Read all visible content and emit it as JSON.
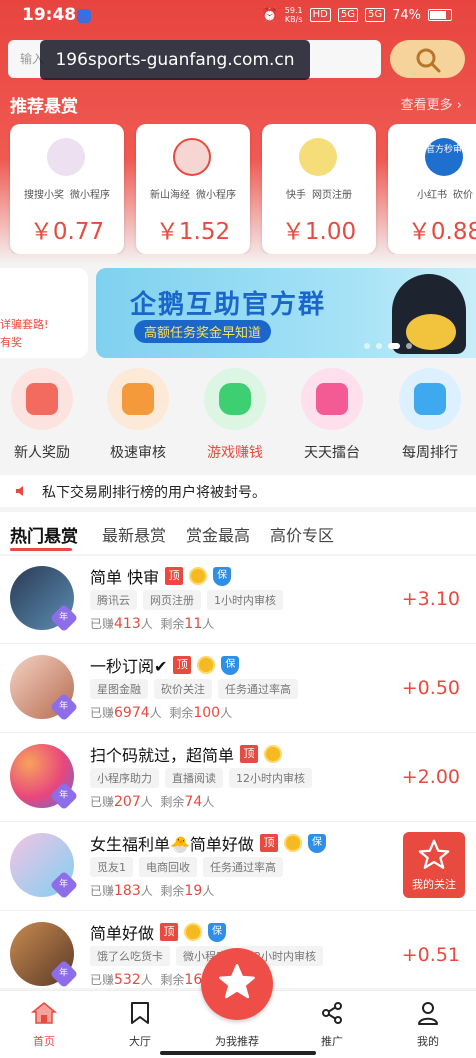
{
  "status_bar": {
    "time": "19:48",
    "speed_top": "59.1",
    "speed_bottom": "KB/s",
    "hd": "HD",
    "net1": "5G",
    "net2": "5G",
    "battery": "74%"
  },
  "search": {
    "placeholder": "输入",
    "overlay_url": "196sports-guanfang.com.cn"
  },
  "recommend": {
    "title": "推荐悬赏",
    "more": "查看更多 ›",
    "cards": [
      {
        "tags": [
          "搜搜小奖",
          "微小程序"
        ],
        "price": "￥0.77"
      },
      {
        "tags": [
          "新山海经",
          "微小程序"
        ],
        "price": "￥1.52"
      },
      {
        "tags": [
          "快手",
          "网页注册"
        ],
        "price": "￥1.00"
      },
      {
        "tags": [
          "小红书",
          "砍价"
        ],
        "price": "￥0.88",
        "badge": "官方秒审"
      }
    ]
  },
  "banner": {
    "left_line1": "详骗套路!",
    "left_line2": "有奖",
    "title": "企鹅互助官方群",
    "subtitle": "高额任务奖金早知道"
  },
  "quick_nav": [
    {
      "label": "新人奖励",
      "color": "#f36b5e"
    },
    {
      "label": "极速审核",
      "color": "#f59a3a"
    },
    {
      "label": "游戏赚钱",
      "color": "#3fcf73"
    },
    {
      "label": "天天擂台",
      "color": "#f45b95"
    },
    {
      "label": "每周排行",
      "color": "#3fa9f0"
    }
  ],
  "notice": "私下交易刷排行榜的用户将被封号。",
  "tabs": [
    "热门悬赏",
    "最新悬赏",
    "赏金最高",
    "高价专区"
  ],
  "tasks": [
    {
      "title": "简单 快审",
      "top": "顶",
      "bao": "保",
      "tags": [
        "腾讯云",
        "网页注册",
        "1小时内审核"
      ],
      "earned_prefix": "已赚",
      "earned": "413",
      "earned_unit": "人",
      "remain_prefix": "剩余",
      "remain": "11",
      "remain_unit": "人",
      "reward": "+3.10",
      "year": "年"
    },
    {
      "title": "一秒订阅✔",
      "top": "顶",
      "bao": "保",
      "tags": [
        "星图金融",
        "砍价关注",
        "任务通过率高"
      ],
      "earned_prefix": "已赚",
      "earned": "6974",
      "earned_unit": "人",
      "remain_prefix": "剩余",
      "remain": "100",
      "remain_unit": "人",
      "reward": "+0.50",
      "year": "年"
    },
    {
      "title": "扫个码就过，超简单",
      "top": "顶",
      "bao": "",
      "tags": [
        "小程序助力",
        "直播阅读",
        "12小时内审核"
      ],
      "earned_prefix": "已赚",
      "earned": "207",
      "earned_unit": "人",
      "remain_prefix": "剩余",
      "remain": "74",
      "remain_unit": "人",
      "reward": "+2.00",
      "year": "年"
    },
    {
      "title": "女生福利单🐣简单好做",
      "top": "顶",
      "bao": "保",
      "tags": [
        "觅友1",
        "电商回收",
        "任务通过率高"
      ],
      "earned_prefix": "已赚",
      "earned": "183",
      "earned_unit": "人",
      "remain_prefix": "剩余",
      "remain": "19",
      "remain_unit": "人",
      "reward": "",
      "year": "年"
    },
    {
      "title": "简单好做",
      "top": "顶",
      "bao": "保",
      "tags": [
        "饿了么吃货卡",
        "微小程序",
        "12小时内审核"
      ],
      "earned_prefix": "已赚",
      "earned": "532",
      "earned_unit": "人",
      "remain_prefix": "剩余",
      "remain": "16",
      "remain_unit": "",
      "reward": "+0.51",
      "year": "年"
    }
  ],
  "favorite_button": "我的关注",
  "bottom_nav": {
    "home": "首页",
    "hall": "大厅",
    "recommend": "为我推荐",
    "promote": "推广",
    "mine": "我的"
  },
  "colors": {
    "brand_red": "#e84a3f",
    "header_red": "#e8443f",
    "gold": "#f6d39b"
  }
}
